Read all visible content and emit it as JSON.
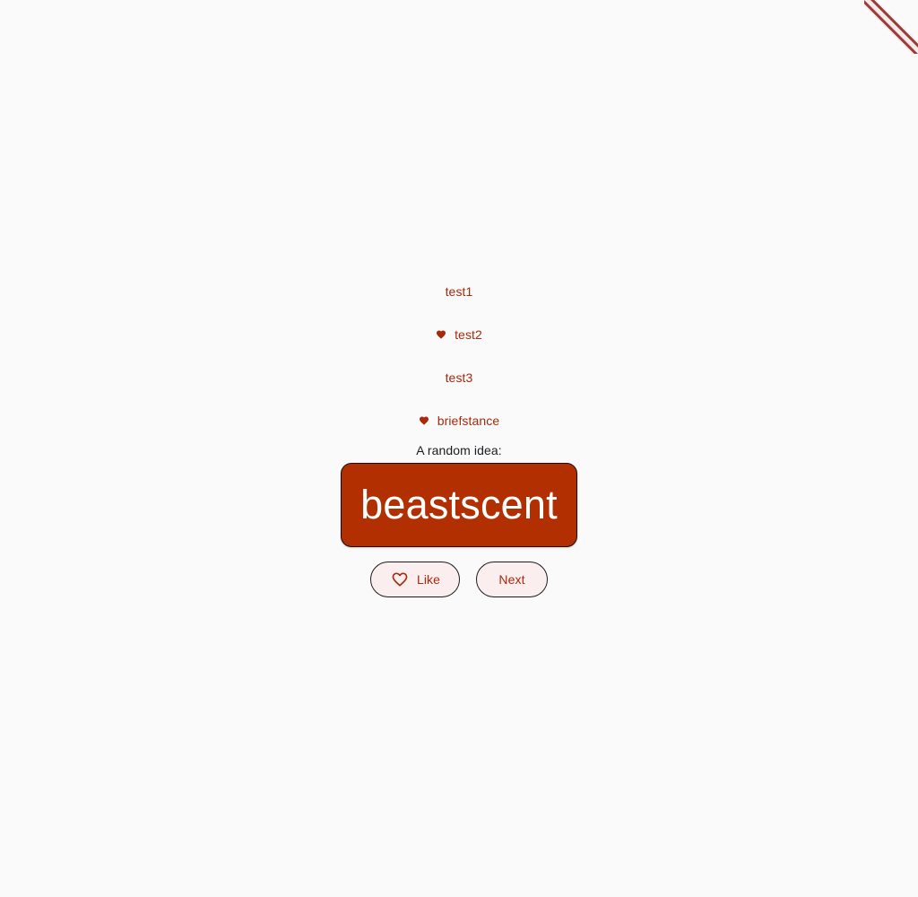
{
  "colors": {
    "background": "#fafafa",
    "primary": "#b12f00",
    "accent_text": "#a8290c",
    "button_bg": "#fbeeee"
  },
  "history": [
    {
      "text": "test1",
      "favorite": false
    },
    {
      "text": "test2",
      "favorite": true
    },
    {
      "text": "test3",
      "favorite": false
    },
    {
      "text": "briefstance",
      "favorite": true
    }
  ],
  "caption": "A random idea:",
  "current_pair": "beastscent",
  "buttons": {
    "like_label": "Like",
    "like_icon": "heart-outline-icon",
    "next_label": "Next"
  },
  "icons": {
    "favorite": "heart-filled-icon"
  }
}
